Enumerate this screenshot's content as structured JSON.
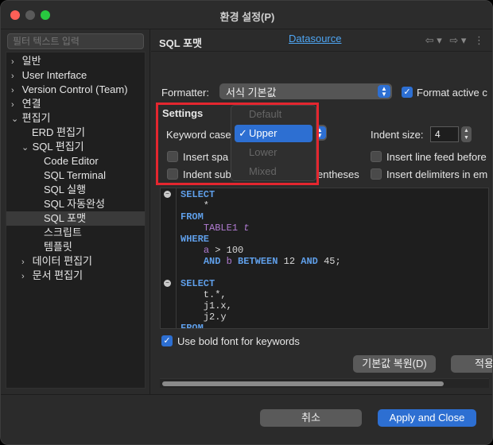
{
  "window": {
    "title": "환경 설정(P)"
  },
  "sidebar": {
    "filter_placeholder": "필터 텍스트 입력",
    "items": [
      {
        "label": "일반",
        "chev": "›"
      },
      {
        "label": "User Interface",
        "chev": "›"
      },
      {
        "label": "Version Control (Team)",
        "chev": "›"
      },
      {
        "label": "연결",
        "chev": "›"
      },
      {
        "label": "편집기",
        "chev": "⌄"
      },
      {
        "label": "ERD 편집기",
        "chev": ""
      },
      {
        "label": "SQL 편집기",
        "chev": "⌄"
      },
      {
        "label": "Code Editor",
        "chev": ""
      },
      {
        "label": "SQL Terminal",
        "chev": ""
      },
      {
        "label": "SQL 실행",
        "chev": ""
      },
      {
        "label": "SQL 자동완성",
        "chev": ""
      },
      {
        "label": "SQL 포맷",
        "chev": ""
      },
      {
        "label": "스크립트",
        "chev": ""
      },
      {
        "label": "템플릿",
        "chev": ""
      },
      {
        "label": "데이터 편집기",
        "chev": "›"
      },
      {
        "label": "문서 편집기",
        "chev": "›"
      }
    ]
  },
  "main": {
    "page_title": "SQL 포맷",
    "nav": {
      "back": "⇦ ▾",
      "forward": "⇨ ▾",
      "menu": "⋮"
    },
    "datasource_link": "Datasource",
    "formatter_label": "Formatter:",
    "formatter_value": "서식 기본값",
    "format_active": {
      "label": "Format active c",
      "checked": true
    },
    "settings_label": "Settings",
    "keyword_case_label": "Keyword case",
    "indent_size_label": "Indent size:",
    "indent_size_value": "4",
    "options": {
      "insert_spa": "Insert spa",
      "indent_sub": "Indent sub",
      "entheses": "entheses",
      "insert_line_feed": "Insert line feed before",
      "insert_delimiters": "Insert delimiters in em"
    },
    "keyword_case_popup": {
      "options": [
        "Default",
        "Upper",
        "Lower",
        "Mixed"
      ],
      "selected": "Upper",
      "tick": "✓"
    },
    "code_preview": {
      "fold_marker": "−",
      "l1": "SELECT",
      "l2": "    *",
      "l3": "FROM",
      "l4_id": "TABLE1",
      "l4_alias": " t",
      "l5": "WHERE",
      "l6_a": "a",
      "l6_rest": " > 100",
      "l7_and1": "AND",
      "l7_b": "b",
      "l7_between": "BETWEEN",
      "l7_12": " 12 ",
      "l7_and2": "AND",
      "l7_end": " 45;",
      "l9": "SELECT",
      "l10": "    t.*,",
      "l11": "    j1.x,",
      "l12": "    j2.y",
      "l13": "FROM"
    },
    "bold_keywords": {
      "label": "Use bold font for keywords",
      "checked": true
    },
    "restore_defaults": "기본값 복원(D)",
    "apply": "적용"
  },
  "footer": {
    "cancel": "취소",
    "apply_close": "Apply and Close"
  },
  "colors": {
    "accent": "#2d6fd2",
    "link": "#4ea6f4",
    "highlight_box": "#e4262f"
  }
}
